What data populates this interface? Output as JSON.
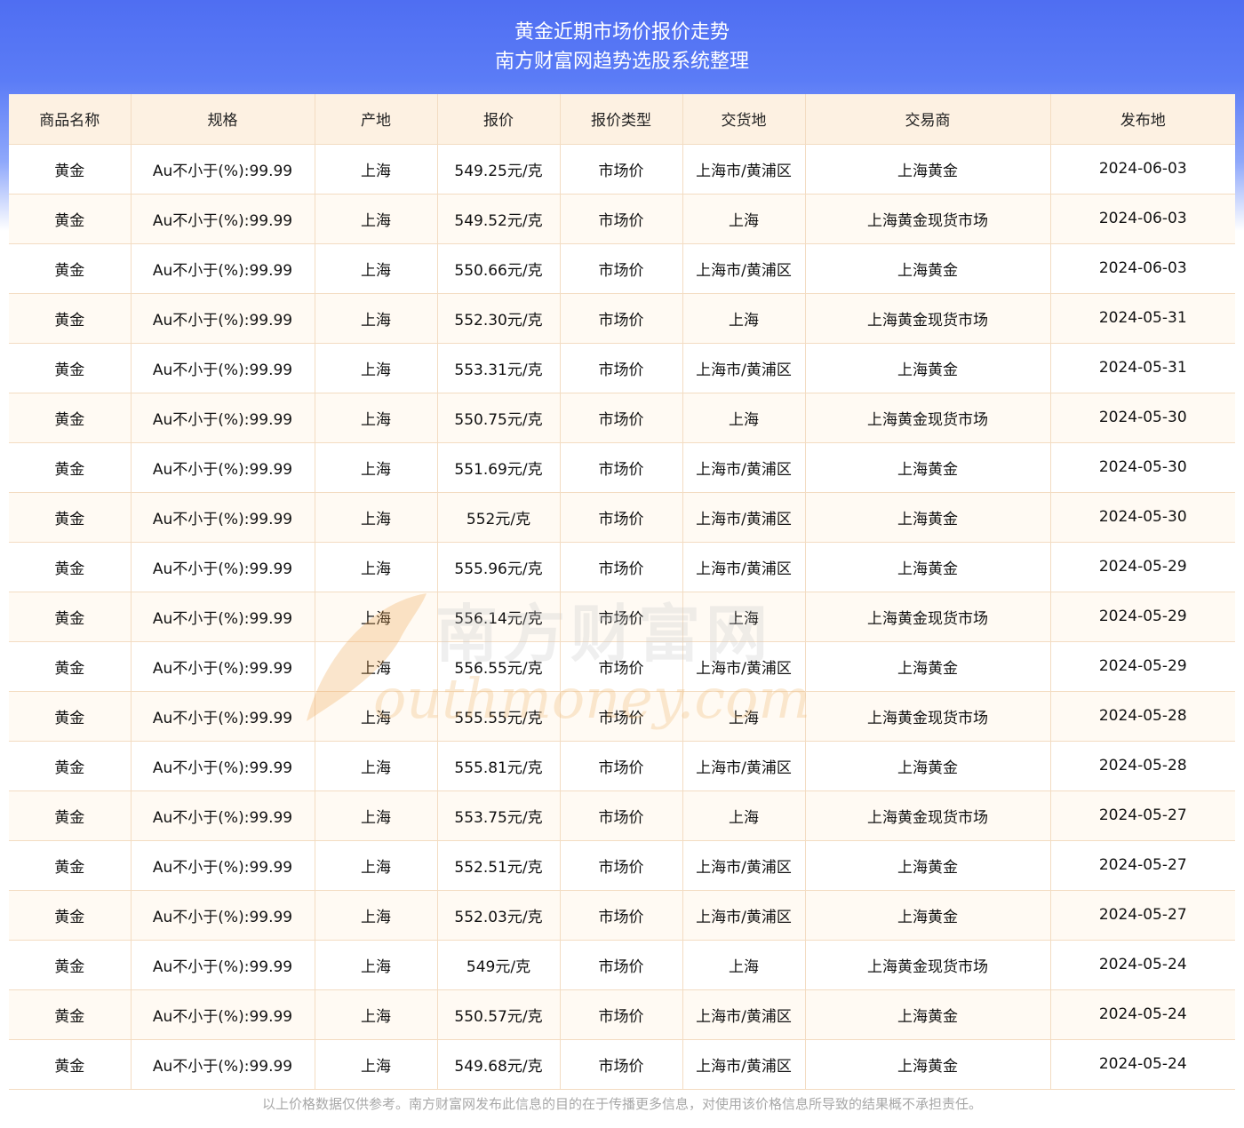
{
  "header": {
    "title_line1": "黄金近期市场价报价走势",
    "title_line2": "南方财富网趋势选股系统整理"
  },
  "table": {
    "columns": [
      "商品名称",
      "规格",
      "产地",
      "报价",
      "报价类型",
      "交货地",
      "交易商",
      "发布地"
    ],
    "rows": [
      [
        "黄金",
        "Au不小于(%):99.99",
        "上海",
        "549.25元/克",
        "市场价",
        "上海市/黄浦区",
        "上海黄金",
        "2024-06-03"
      ],
      [
        "黄金",
        "Au不小于(%):99.99",
        "上海",
        "549.52元/克",
        "市场价",
        "上海",
        "上海黄金现货市场",
        "2024-06-03"
      ],
      [
        "黄金",
        "Au不小于(%):99.99",
        "上海",
        "550.66元/克",
        "市场价",
        "上海市/黄浦区",
        "上海黄金",
        "2024-06-03"
      ],
      [
        "黄金",
        "Au不小于(%):99.99",
        "上海",
        "552.30元/克",
        "市场价",
        "上海",
        "上海黄金现货市场",
        "2024-05-31"
      ],
      [
        "黄金",
        "Au不小于(%):99.99",
        "上海",
        "553.31元/克",
        "市场价",
        "上海市/黄浦区",
        "上海黄金",
        "2024-05-31"
      ],
      [
        "黄金",
        "Au不小于(%):99.99",
        "上海",
        "550.75元/克",
        "市场价",
        "上海",
        "上海黄金现货市场",
        "2024-05-30"
      ],
      [
        "黄金",
        "Au不小于(%):99.99",
        "上海",
        "551.69元/克",
        "市场价",
        "上海市/黄浦区",
        "上海黄金",
        "2024-05-30"
      ],
      [
        "黄金",
        "Au不小于(%):99.99",
        "上海",
        "552元/克",
        "市场价",
        "上海市/黄浦区",
        "上海黄金",
        "2024-05-30"
      ],
      [
        "黄金",
        "Au不小于(%):99.99",
        "上海",
        "555.96元/克",
        "市场价",
        "上海市/黄浦区",
        "上海黄金",
        "2024-05-29"
      ],
      [
        "黄金",
        "Au不小于(%):99.99",
        "上海",
        "556.14元/克",
        "市场价",
        "上海",
        "上海黄金现货市场",
        "2024-05-29"
      ],
      [
        "黄金",
        "Au不小于(%):99.99",
        "上海",
        "556.55元/克",
        "市场价",
        "上海市/黄浦区",
        "上海黄金",
        "2024-05-29"
      ],
      [
        "黄金",
        "Au不小于(%):99.99",
        "上海",
        "555.55元/克",
        "市场价",
        "上海",
        "上海黄金现货市场",
        "2024-05-28"
      ],
      [
        "黄金",
        "Au不小于(%):99.99",
        "上海",
        "555.81元/克",
        "市场价",
        "上海市/黄浦区",
        "上海黄金",
        "2024-05-28"
      ],
      [
        "黄金",
        "Au不小于(%):99.99",
        "上海",
        "553.75元/克",
        "市场价",
        "上海",
        "上海黄金现货市场",
        "2024-05-27"
      ],
      [
        "黄金",
        "Au不小于(%):99.99",
        "上海",
        "552.51元/克",
        "市场价",
        "上海市/黄浦区",
        "上海黄金",
        "2024-05-27"
      ],
      [
        "黄金",
        "Au不小于(%):99.99",
        "上海",
        "552.03元/克",
        "市场价",
        "上海市/黄浦区",
        "上海黄金",
        "2024-05-27"
      ],
      [
        "黄金",
        "Au不小于(%):99.99",
        "上海",
        "549元/克",
        "市场价",
        "上海",
        "上海黄金现货市场",
        "2024-05-24"
      ],
      [
        "黄金",
        "Au不小于(%):99.99",
        "上海",
        "550.57元/克",
        "市场价",
        "上海市/黄浦区",
        "上海黄金",
        "2024-05-24"
      ],
      [
        "黄金",
        "Au不小于(%):99.99",
        "上海",
        "549.68元/克",
        "市场价",
        "上海市/黄浦区",
        "上海黄金",
        "2024-05-24"
      ]
    ]
  },
  "watermark": {
    "cn_text": "南方财富网",
    "en_text": "outhmoney.com"
  },
  "footer": {
    "note": "以上价格数据仅供参考。南方财富网发布此信息的目的在于传播更多信息，对使用该价格信息所导致的结果概不承担责任。"
  },
  "colors": {
    "header_gradient_top": "#4f6ef2",
    "header_bg": "#fdf1e2",
    "row_alt_bg": "#fffaf3",
    "border": "#f3dcc2",
    "watermark_accent": "#f0a34a",
    "footer_text": "#a8a8a8"
  }
}
